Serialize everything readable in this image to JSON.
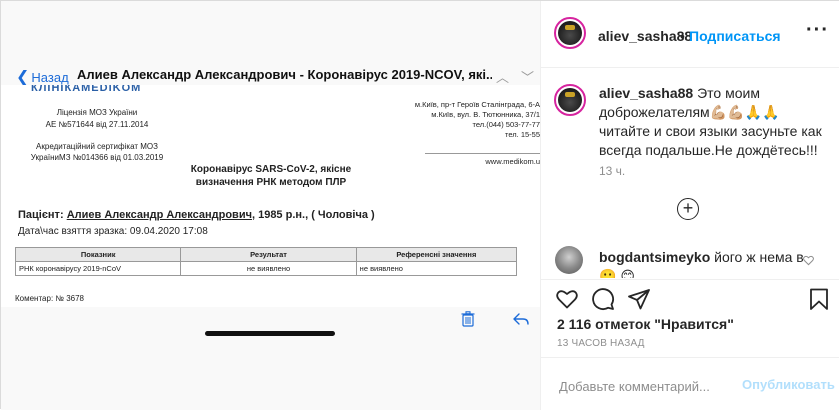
{
  "mail": {
    "back_label": "Назад",
    "back_chevron": "❮",
    "subject": "Алиев Александр Александрович - Коронавірус 2019-NCOV, які...",
    "up_glyph": "︿",
    "down_glyph": "﹀"
  },
  "doc": {
    "logo": "КЛІНІКАMEDIKOM",
    "license_line1": "Ліцензія МОЗ України",
    "license_line2": "АЕ №571644 від 27.11.2014",
    "cert_line1": "Акредитаційний сертифікат МОЗ",
    "cert_line2": "УкраїниМЗ №014366 від 01.03.2019",
    "addr_line1": "м.Київ, пр-т Героїв Сталінграда, 6-А",
    "addr_line2": "м.Київ, вул. В. Тютюнника, 37/1",
    "addr_line3": "тел.(044) 503-77-77",
    "addr_line4": "тел. 15-55",
    "site": "www.medikom.u",
    "heading_line1": "Коронавірус SARS-CoV-2, якісне",
    "heading_line2": "визначення РНК методом ПЛР",
    "patient_label": "Пацієнт:",
    "patient_name": "Алиев Александр Александрович",
    "patient_rest": ",  1985 р.н., ( Чоловіча )",
    "date_text": "Дата\\час взяття зразка:  09.04.2020  17:08",
    "table": {
      "headers": [
        "Показник",
        "Результат",
        "Референсні значення"
      ],
      "rows": [
        [
          "РНК коронавірусу 2019-nCoV",
          "не виявлено",
          "не виявлено"
        ]
      ]
    },
    "comment": "Коментар:    № 3678"
  },
  "post": {
    "username": "aliev_sasha88",
    "dot": "•",
    "follow_label": "Подписаться",
    "more_glyph": "···",
    "caption_user": "aliev_sasha88",
    "caption_text": " Это моим доброжелателям💪🏼💪🏼🙏🙏 читайте и свои языки засуньте как всегда подальше.Не дождётесь!!!",
    "caption_time": "13 ч.",
    "load_more": "+",
    "comment2_user": "bogdantsimeyko",
    "comment2_text": " його ж нема в 🙂 😊",
    "likes": "2 116 отметок \"Нравится\"",
    "post_time": "13 ЧАСОВ НАЗАД",
    "add_comment_placeholder": "Добавьте комментарий...",
    "publish_label": "Опубликовать"
  },
  "colors": {
    "link": "#0095f6",
    "publish_disabled": "#b2dffc",
    "mail_blue": "#1c6bd8"
  }
}
